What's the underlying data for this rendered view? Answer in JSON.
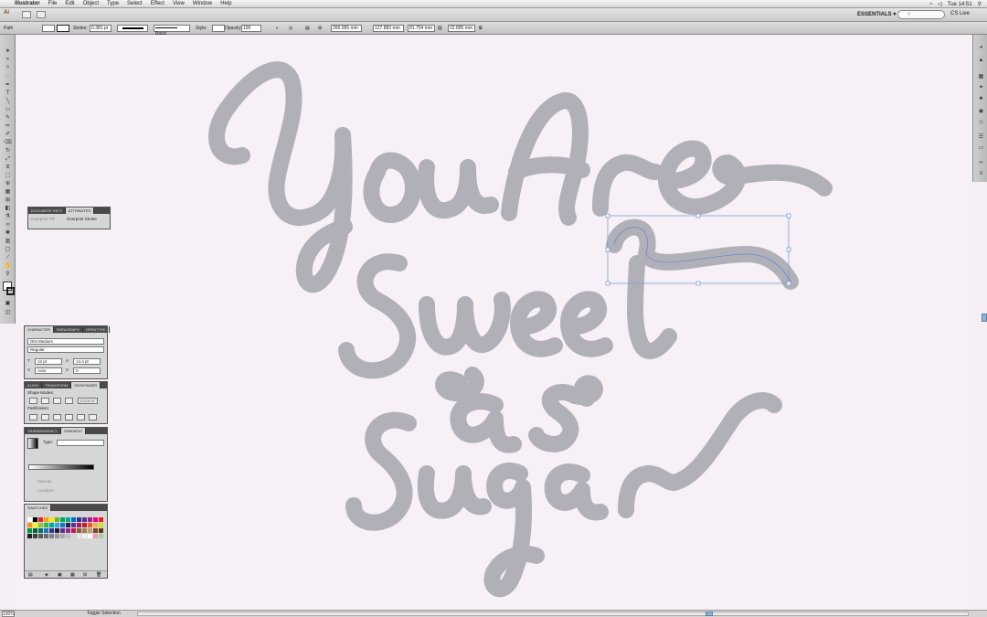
{
  "menubar": {
    "app_name": "Illustrator",
    "items": [
      "File",
      "Edit",
      "Object",
      "Type",
      "Select",
      "Effect",
      "View",
      "Window",
      "Help"
    ],
    "clock": "Tue 14:51"
  },
  "appbar": {
    "workspace": "ESSENTIALS ▾",
    "cs_live": "CS Live"
  },
  "controlbar": {
    "selection_label": "Path",
    "stroke_label": "Stroke:",
    "stroke_weight": "0.381 pt",
    "brush_label": "Basic",
    "style_label": "Style:",
    "opacity_label": "Opacity:",
    "opacity_value": "100",
    "x_value": "266.055 mm",
    "y_value": "127.883 mm",
    "w_value": "81.754 mm",
    "h_value": "22.895 mm"
  },
  "artwork": {
    "line1": "You Are",
    "line2": "Sweet",
    "line3": "as",
    "line4": "Sugar",
    "letter_color": "#b1b0b8"
  },
  "panel_transparency": {
    "tabs": [
      "DOCUMENT INFO",
      "ATTRIBUTES"
    ],
    "overprint_fill": "Overprint Fill",
    "overprint_stroke": "Overprint Stroke"
  },
  "panel_character": {
    "tabs": [
      "CHARACTER",
      "PARAGRAPH",
      "OPENTYPE"
    ],
    "font": "DIN Medium",
    "style": "Regular",
    "size": "12 pt",
    "leading": "14.4 pt",
    "kerning": "Auto",
    "tracking": "0"
  },
  "panel_pathfinder": {
    "tabs": [
      "ALIGN",
      "TRANSFORM",
      "PATHFINDER"
    ],
    "shape_modes": "Shape Modes:",
    "pathfinders": "Pathfinders:",
    "expand": "Expand"
  },
  "panel_gradient": {
    "tabs": [
      "TRANSPARENCY",
      "GRADIENT"
    ],
    "type_label": "Type:",
    "opacity_label": "Opacity:",
    "location_label": "Location:"
  },
  "panel_swatches": {
    "tabs": [
      "SWATCHES"
    ],
    "colors": [
      "#ffffff",
      "#000000",
      "#e8262a",
      "#f6a01a",
      "#ffe600",
      "#6ab42d",
      "#00a651",
      "#00a99d",
      "#0072bc",
      "#2e3192",
      "#662d91",
      "#92278f",
      "#ec008c",
      "#ed1c24",
      "#f7941d",
      "#fff200",
      "#8dc63f",
      "#39b54a",
      "#00a79d",
      "#27aae1",
      "#1c75bc",
      "#262262",
      "#652d90",
      "#9e1f63",
      "#be1e2d",
      "#f15a29",
      "#fbb040",
      "#d7df23",
      "#009444",
      "#006838",
      "#00746b",
      "#1b75bb",
      "#2b3990",
      "#1d1d3a",
      "#5c2d91",
      "#92278f",
      "#c2185b",
      "#8b5e3c",
      "#a97c50",
      "#c69c6d",
      "#754c24",
      "#603913",
      "#231f20",
      "#414042",
      "#58595b",
      "#6d6e71",
      "#808285",
      "#939598",
      "#a7a9ac",
      "#bcbec0",
      "#d1d3d4",
      "#e6e7e8",
      "#f1f2f2",
      "#ffffff",
      "#f49ac1",
      "#a3d39c"
    ]
  },
  "status": {
    "zoom": "100%",
    "tool": "Toggle Selection"
  }
}
